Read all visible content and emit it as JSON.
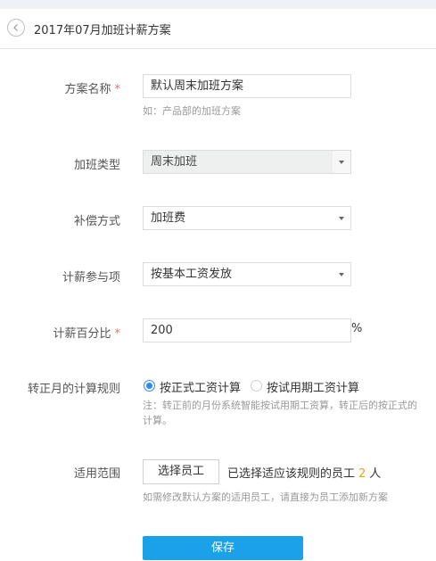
{
  "header": {
    "title": "2017年07月加班计薪方案"
  },
  "form": {
    "scheme_name": {
      "label": "方案名称",
      "required_mark": "*",
      "value": "默认周末加班方案",
      "hint": "如：产品部的加班方案"
    },
    "overtime_type": {
      "label": "加班类型",
      "value": "周末加班"
    },
    "compensation": {
      "label": "补偿方式",
      "value": "加班费"
    },
    "pay_item": {
      "label": "计薪参与项",
      "value": "按基本工资发放"
    },
    "pay_percent": {
      "label": "计薪百分比",
      "required_mark": "*",
      "value": "200",
      "unit": "%"
    },
    "regularization_rule": {
      "label": "转正月的计算规则",
      "options": [
        {
          "label": "按正式工资计算",
          "checked": true
        },
        {
          "label": "按试用期工资计算",
          "checked": false
        }
      ],
      "note_line1": "注：转正前的月份系统智能按试用期工资算，转正后的按正式的",
      "note_line2": "计算。"
    },
    "scope": {
      "label": "适用范围",
      "button_label": "选择员工",
      "selected_prefix": "已选择适应该规则的员工",
      "selected_count": "2",
      "selected_suffix": "人",
      "hint": "如需修改默认方案的适用员工，请直接为员工添加新方案"
    }
  },
  "actions": {
    "save_label": "保存"
  },
  "colors": {
    "accent": "#1aa1e8",
    "radio_checked": "#2d8cf0",
    "required": "#ff6a6a",
    "count": "#f0a01e"
  }
}
